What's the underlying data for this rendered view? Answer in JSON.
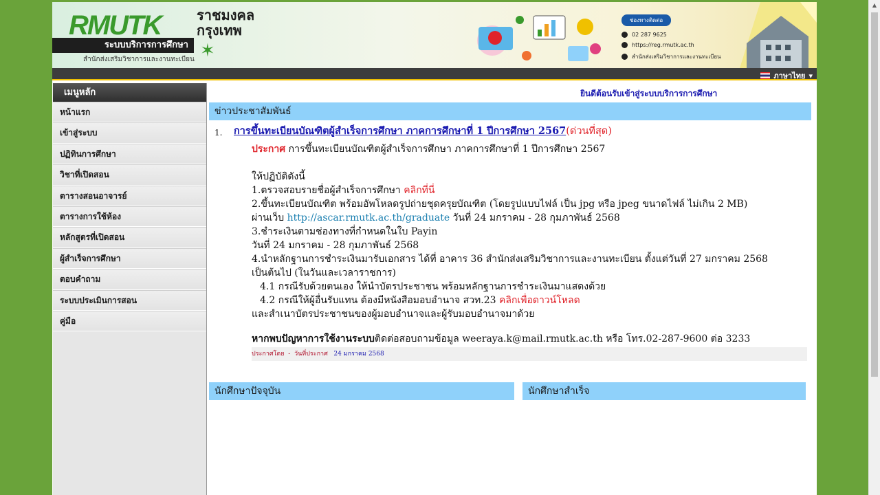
{
  "header": {
    "logo_text": "RMUTK",
    "logo_th_line1": "ราชมงคล",
    "logo_th_line2": "กรุงเทพ",
    "system_name": "ระบบบริการการศึกษา",
    "office_name": "สำนักส่งเสริมวิชาการและงานทะเบียน",
    "contact_title": "ช่องทางติดต่อ",
    "contact_phone": "02 287 9625",
    "contact_web": "https://reg.rmutk.ac.th",
    "contact_fb": "สำนักส่งเสริมวิชาการและงานทะเบียน"
  },
  "language": {
    "label": "ภาษาไทย"
  },
  "sidebar": {
    "title": "เมนูหลัก",
    "items": [
      {
        "label": "หน้าแรก"
      },
      {
        "label": "เข้าสู่ระบบ"
      },
      {
        "label": "ปฏิทินการศึกษา"
      },
      {
        "label": "วิชาที่เปิดสอน"
      },
      {
        "label": "ตารางสอนอาจารย์"
      },
      {
        "label": "ตารางการใช้ห้อง"
      },
      {
        "label": "หลักสูตรที่เปิดสอน"
      },
      {
        "label": "ผู้สำเร็จการศึกษา"
      },
      {
        "label": "ตอบคำถาม"
      },
      {
        "label": "ระบบประเมินการสอน"
      },
      {
        "label": "คู่มือ"
      }
    ]
  },
  "main": {
    "welcome": "ยินดีต้อนรับเข้าสู่ระบบบริการการศึกษา",
    "news_section_title": "ข่าวประชาสัมพันธ์",
    "news": {
      "number": "1.",
      "headline": "การขึ้นทะเบียนบัณฑิตผู้สำเร็จการศึกษา ภาคการศึกษาที่ 1 ปีการศึกษา 2567",
      "urgent": "(ด่วนที่สุด)",
      "announce_label": "ประกาศ",
      "announce_text": " การขึ้นทะเบียนบัณฑิตผู้สำเร็จการศึกษา ภาคการศึกษาที่ 1 ปีการศึกษา 2567",
      "instructions_intro": "ให้ปฏิบัติดังนี้",
      "step1_text": "1.ตรวจสอบรายชื่อผู้สำเร็จการศึกษา ",
      "step1_link": "คลิกที่นี่",
      "step2_text": "2.ขึ้นทะเบียนบัณฑิต พร้อมอัพโหลดรูปถ่ายชุดครุยบัณฑิต (โดยรูปแบบไฟล์ เป็น jpg หรือ jpeg ขนาดไฟล์ ไม่เกิน 2 MB)",
      "step2_via": "ผ่านเว็บ ",
      "step2_link": "http://ascar.rmutk.ac.th/graduate",
      "step2_date": " วันที่ 24 มกราคม - 28 กุมภาพันธ์ 2568",
      "step3_text": "3.ชำระเงินตามช่องทางที่กำหนดในใบ Payin",
      "step3_date": "วันที่ 24 มกราคม - 28 กุมภาพันธ์ 2568",
      "step4_text": "4.นำหลักฐานการชำระเงินมารับเอกสาร ได้ที่ อาคาร 36 สำนักส่งเสริมวิชาการและงานทะเบียน ตั้งแต่วันที่ 27 มกราคม 2568",
      "step4_cont": "เป็นต้นไป (ในวันและเวลาราชการ)",
      "step41": "4.1 กรณีรับด้วยตนเอง ให้นำบัตรประชาชน พร้อมหลักฐานการชำระเงินมาแสดงด้วย",
      "step42_text": "4.2 กรณีให้ผู้อื่นรับแทน ต้องมีหนังสือมอบอำนาจ สวท.23 ",
      "step42_link": "คลิกเพื่อดาวน์โหลด",
      "step42_cont": "และสำเนาบัตรประชาชนของผู้มอบอำนาจและผู้รับมอบอำนาจมาด้วย",
      "help_bold": "หากพบปัญหาการใช้งานระบบ",
      "help_text": "ติดต่อสอบถามข้อมูล weeraya.k@mail.rmutk.ac.th หรือ โทร.02-287-9600 ต่อ 3233",
      "meta_by": "ประกาศโดย",
      "meta_sep": "-",
      "meta_date_label": "วันที่ประกาศ",
      "meta_date": "24 มกราคม 2568"
    },
    "current_students_title": "นักศึกษาปัจจุบัน",
    "graduates_title": "นักศึกษาสำเร็จ"
  },
  "colors": {
    "page_bg": "#6aa33a",
    "section_bar": "#8fd1fa",
    "link_blue": "#1a1ab0",
    "alert_red": "#e0232a"
  }
}
